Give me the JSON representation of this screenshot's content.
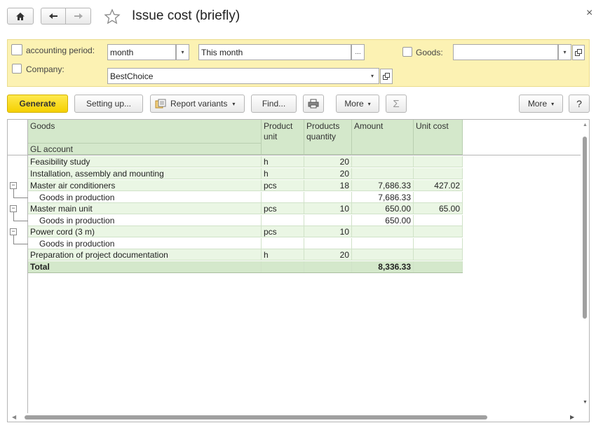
{
  "window": {
    "title": "Issue cost (briefly)",
    "close_glyph": "×"
  },
  "nav": {
    "home_icon": "home-icon",
    "back_icon": "back-arrow-icon",
    "forward_icon": "forward-arrow-icon",
    "favorite_icon": "star-icon"
  },
  "filters": {
    "period_label": "accounting period:",
    "period_kind": "month",
    "period_value": "This month",
    "period_select_glyph": "...",
    "company_label": "Company:",
    "company_value": "BestChoice",
    "goods_label": "Goods:",
    "goods_value": ""
  },
  "toolbar": {
    "generate": "Generate",
    "setting_up": "Setting up...",
    "report_variants": "Report variants",
    "find": "Find...",
    "more_left": "More",
    "sum_glyph": "Σ",
    "more_right": "More",
    "help": "?"
  },
  "table": {
    "headers": {
      "goods": "Goods",
      "gl_account": "GL account",
      "product_unit": "Product unit",
      "products_quantity": "Products quantity",
      "amount": "Amount",
      "unit_cost": "Unit cost"
    },
    "rows": [
      {
        "name": "Feasibility study",
        "unit": "h",
        "qty": "20",
        "amount": "",
        "cost": ""
      },
      {
        "name": "Installation, assembly and mounting",
        "unit": "h",
        "qty": "20",
        "amount": "",
        "cost": ""
      },
      {
        "name": "Master air conditioners",
        "unit": "pcs",
        "qty": "18",
        "amount": "7,686.33",
        "cost": "427.02"
      },
      {
        "name": "Goods in production",
        "unit": "",
        "qty": "",
        "amount": "7,686.33",
        "cost": ""
      },
      {
        "name": "Master main unit",
        "unit": "pcs",
        "qty": "10",
        "amount": "650.00",
        "cost": "65.00"
      },
      {
        "name": "Goods in production",
        "unit": "",
        "qty": "",
        "amount": "650.00",
        "cost": ""
      },
      {
        "name": "Power cord (3 m)",
        "unit": "pcs",
        "qty": "10",
        "amount": "",
        "cost": ""
      },
      {
        "name": "Goods in production",
        "unit": "",
        "qty": "",
        "amount": "",
        "cost": ""
      },
      {
        "name": "Preparation of project documentation",
        "unit": "h",
        "qty": "20",
        "amount": "",
        "cost": ""
      }
    ],
    "total": {
      "label": "Total",
      "amount": "8,336.33"
    },
    "collapse_glyph": "−"
  }
}
